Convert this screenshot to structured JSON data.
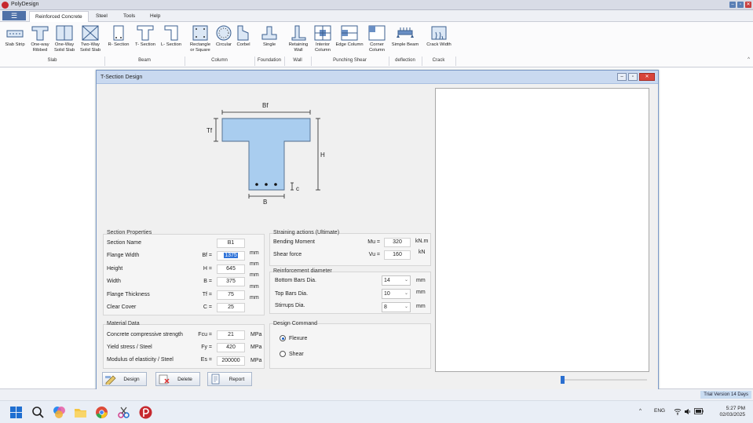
{
  "window": {
    "title": "PolyDesign",
    "btn_min": "–",
    "btn_max": "▫",
    "btn_close": "✕"
  },
  "menu": {
    "hamburger": "☰",
    "tabs": [
      "Reinforced Concrete",
      "Steel",
      "Tools",
      "Help"
    ]
  },
  "ribbon": {
    "buttons": [
      "Slab Strip",
      "One-way\nRibbed",
      "One-Way\nSolid Slab",
      "Two-Way\nSolid Slab",
      "R- Section",
      "T- Section",
      "L- Section",
      "Rectangle\nor Square",
      "Circular",
      "Corbel",
      "Single",
      "Retaining\nWall",
      "Interior\nColumn",
      "Edge Column",
      "Corner\nColumn",
      "Simple Beam",
      "Crack Width"
    ],
    "groups": [
      "Slab",
      "Beam",
      "Column",
      "Foundation",
      "Wall",
      "Punching Shear",
      "deflection",
      "Crack"
    ],
    "collapse": "^"
  },
  "dialog": {
    "title": "T-Section Design",
    "diagram": {
      "bf": "Bf",
      "tf": "Tf",
      "h": "H",
      "b": "B",
      "c": "c"
    },
    "section_properties": {
      "title": "Section Properties",
      "rows": [
        {
          "label": "Section Name",
          "symbol": "",
          "value": "B1",
          "unit": ""
        },
        {
          "label": "Flange Width",
          "symbol": "Bf =",
          "value": "1375",
          "unit": "mm"
        },
        {
          "label": "Height",
          "symbol": "H =",
          "value": "645",
          "unit": "mm"
        },
        {
          "label": "Width",
          "symbol": "B =",
          "value": "375",
          "unit": "mm"
        },
        {
          "label": "Flange Thickness",
          "symbol": "Tf =",
          "value": "75",
          "unit": "mm"
        },
        {
          "label": "Clear Cover",
          "symbol": "C =",
          "value": "25",
          "unit": "mm"
        }
      ]
    },
    "material": {
      "title": "Material Data",
      "rows": [
        {
          "label": "Concrete compressive strength",
          "symbol": "Fcu =",
          "value": "21",
          "unit": "MPa"
        },
        {
          "label": "Yield stress / Steel",
          "symbol": "Fy =",
          "value": "420",
          "unit": "MPa"
        },
        {
          "label": "Modulus of elasticity / Steel",
          "symbol": "Es =",
          "value": "200000",
          "unit": "MPa"
        }
      ]
    },
    "straining": {
      "title": "Straining actions (Ultimate)",
      "rows": [
        {
          "label": "Bending Moment",
          "symbol": "Mu =",
          "value": "320",
          "unit": "kN.m"
        },
        {
          "label": "Shear force",
          "symbol": "Vu =",
          "value": "160",
          "unit": "kN"
        }
      ]
    },
    "reinforcement": {
      "title": "Reinforcement diameter",
      "rows": [
        {
          "label": "Bottom Bars Dia.",
          "value": "14",
          "unit": "mm"
        },
        {
          "label": "Top Bars Dia.",
          "value": "10",
          "unit": "mm"
        },
        {
          "label": "Stirrups Dia.",
          "value": "8",
          "unit": "mm"
        }
      ]
    },
    "command": {
      "title": "Design Command",
      "options": [
        "Flexure",
        "Shear"
      ],
      "selected": "Flexure"
    },
    "buttons": [
      "Design",
      "Delete",
      "Report"
    ],
    "zoom_level": 0.0
  },
  "status": {
    "trial": "Trial Version 14 Days"
  },
  "taskbar": {
    "lang": "ENG",
    "time": "5:27 PM",
    "date": "02/03/2025",
    "tray_arrow": "^"
  }
}
